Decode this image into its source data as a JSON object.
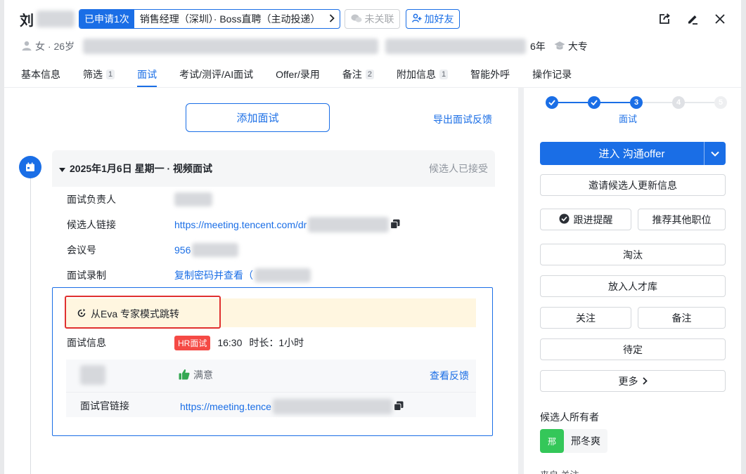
{
  "header": {
    "candidate_name": "刘",
    "applied_badge": "已申请1次",
    "applied_job": "销售经理（深圳）· Boss直聘（主动投递）",
    "unlinked_label": "未关联",
    "add_friend_label": "加好友",
    "gender_age": "女 · 26岁",
    "experience": "6年",
    "education": "大专"
  },
  "tabs": [
    {
      "label": "基本信息",
      "count": ""
    },
    {
      "label": "筛选",
      "count": "1"
    },
    {
      "label": "面试",
      "count": ""
    },
    {
      "label": "考试/测评/AI面试",
      "count": ""
    },
    {
      "label": "Offer/录用",
      "count": ""
    },
    {
      "label": "备注",
      "count": "2"
    },
    {
      "label": "附加信息",
      "count": "1"
    },
    {
      "label": "智能外呼",
      "count": ""
    },
    {
      "label": "操作记录",
      "count": ""
    }
  ],
  "main": {
    "add_interview_label": "添加面试",
    "export_feedback_label": "导出面试反馈",
    "interview": {
      "title": "2025年1月6日 星期一 · 视频面试",
      "status": "候选人已接受",
      "fields": [
        {
          "label": "面试负责人",
          "value": ""
        },
        {
          "label": "候选人链接",
          "value": "https://meeting.tencent.com/dr"
        },
        {
          "label": "会议号",
          "value": "956"
        },
        {
          "label": "面试录制",
          "value": "复制密码并查看（"
        }
      ],
      "eva_jump_label": "从Eva 专家模式跳转",
      "info_label": "面试信息",
      "round_tag": "HR面试",
      "time": "16:30",
      "duration": "时长：1小时",
      "feedback": {
        "result": "满意",
        "view_label": "查看反馈",
        "interviewer_link_label": "面试官链接",
        "interviewer_link": "https://meeting.tence"
      }
    }
  },
  "right_panel": {
    "steps": [
      "1",
      "2",
      "3",
      "4",
      "5"
    ],
    "current_step_label": "面试",
    "primary_action": "进入 沟通offer",
    "actions": {
      "invite_update": "邀请候选人更新信息",
      "follow_up": "跟进提醒",
      "recommend_other": "推荐其他职位",
      "reject": "淘汰",
      "talent_pool": "放入人才库",
      "follow": "关注",
      "note": "备注",
      "pending": "待定",
      "more": "更多"
    },
    "owner_label": "候选人所有者",
    "owner_avatar_text": "邢",
    "owner_name": "邢冬爽",
    "cut_off_label": "来自 关注"
  },
  "colors": {
    "accent": "#1a6ee6",
    "danger": "#e0302f",
    "highlight_bg": "#fff6e0",
    "owner_avatar": "#34c759"
  }
}
